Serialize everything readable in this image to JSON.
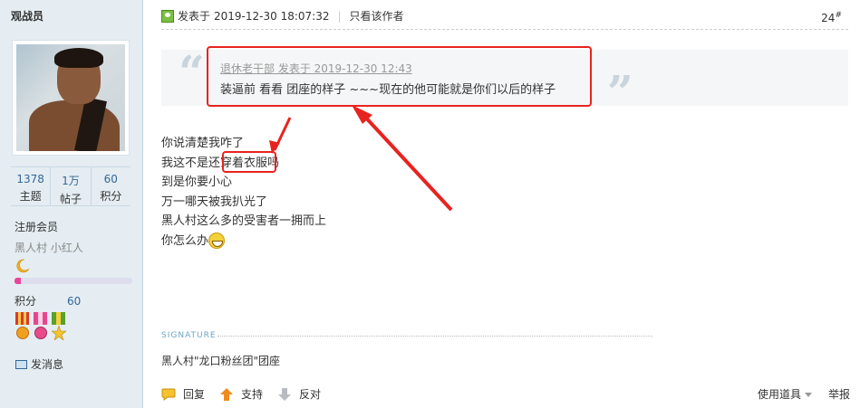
{
  "user": {
    "name": "观战员",
    "stats": [
      {
        "value": "1378",
        "label": "主题"
      },
      {
        "value": "1万",
        "label": "帖子"
      },
      {
        "value": "60",
        "label": "积分"
      }
    ],
    "group": "注册会员",
    "ranks": "黑人村 小红人",
    "level_progress": 0.05,
    "points_label": "积分",
    "points_value": "60",
    "send_message": "发消息"
  },
  "post": {
    "posted_label": "发表于",
    "posted_time": "2019-12-30 18:07:32",
    "only_author": "只看该作者",
    "floor": "24",
    "floor_sup": "#",
    "quote": {
      "author_line": "退休老干部 发表于 2019-12-30 12:43",
      "text": "装逼前 看看 团座的样子 ~~~现在的他可能就是你们以后的样子"
    },
    "lines": [
      "你说清楚我咋了",
      "我这不是还穿着衣服吗",
      "到是你要小心",
      "万一哪天被我扒光了",
      "黑人村这么多的受害者一拥而上",
      "你怎么办"
    ],
    "highlight": "穿着衣服",
    "signature_label": "SIGNATURE",
    "signature": "黑人村\"龙口粉丝团\"团座"
  },
  "footer": {
    "reply": "回复",
    "support": "支持",
    "oppose": "反对",
    "tools": "使用道具",
    "report": "举报"
  },
  "colors": {
    "annotation": "#e8231f",
    "link": "#336699",
    "sidebar_bg": "#e5edf2"
  }
}
